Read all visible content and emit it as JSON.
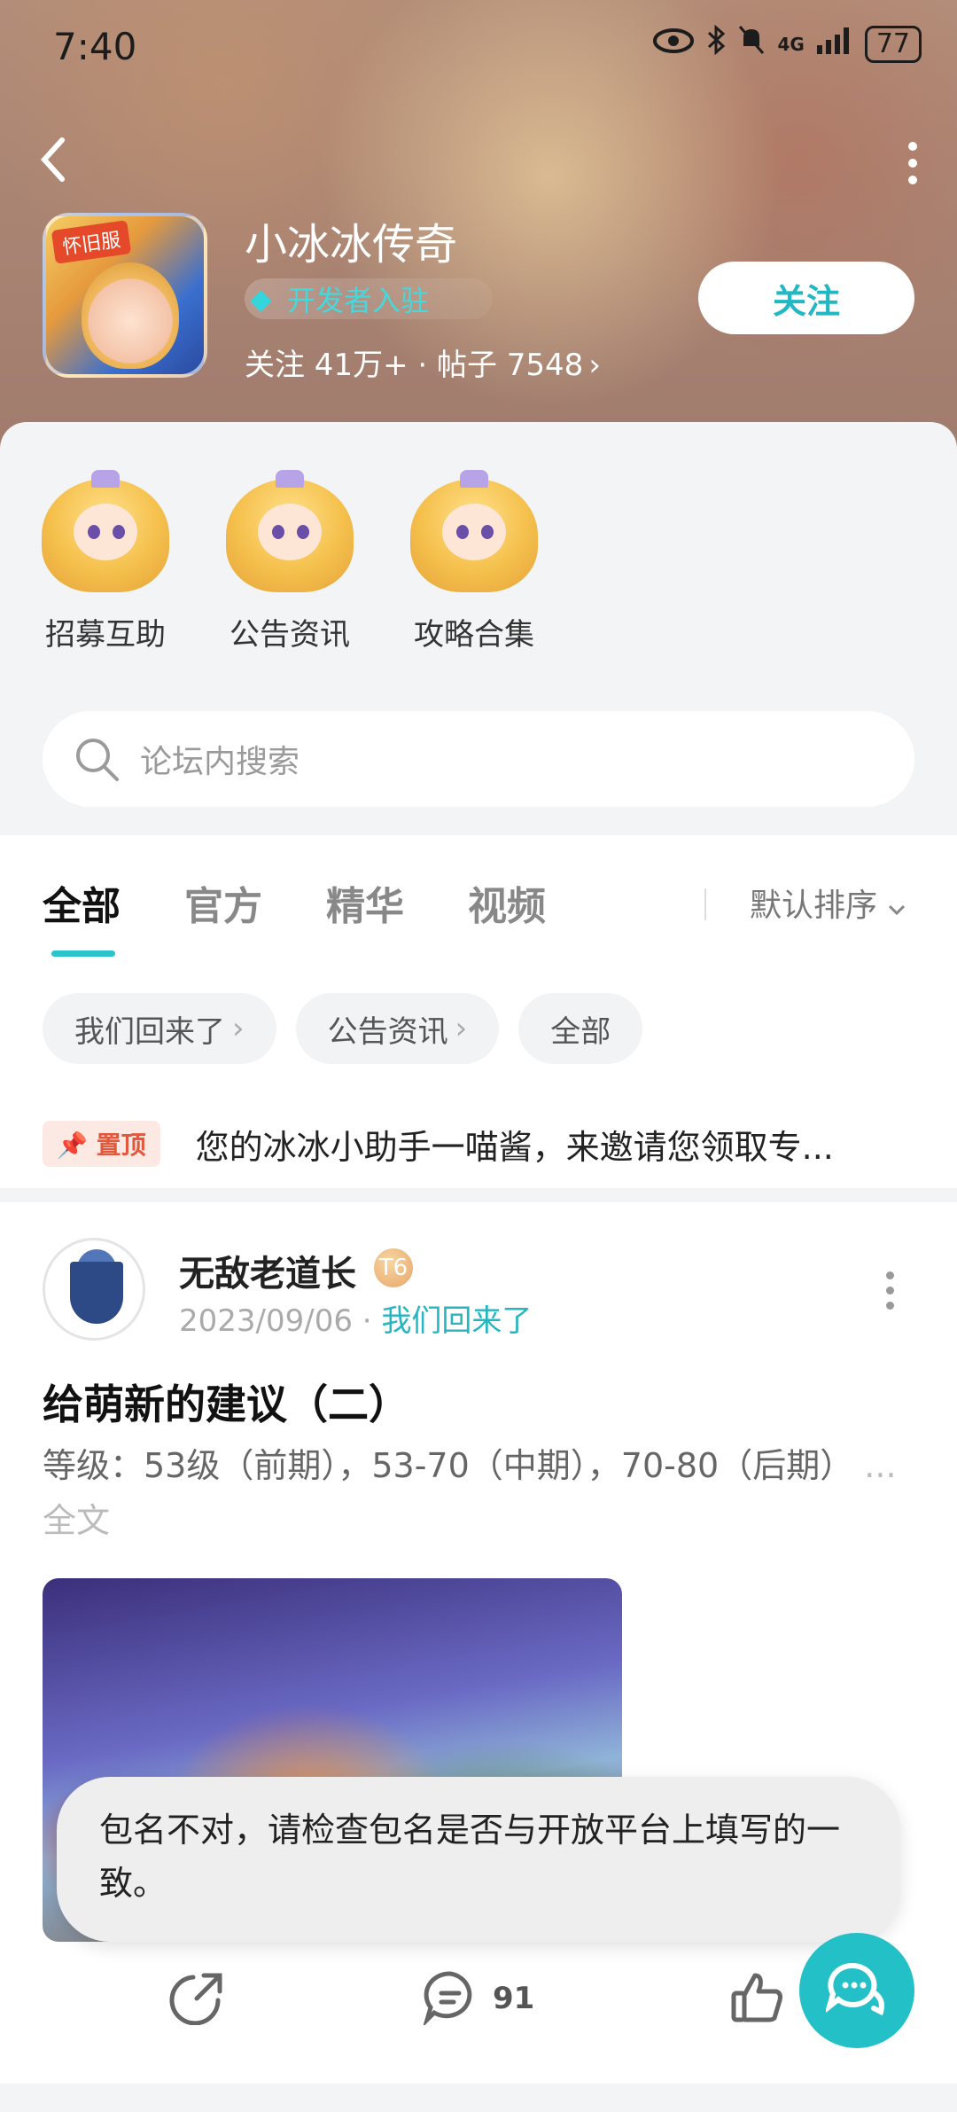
{
  "status_bar": {
    "time": "7:40",
    "network": "4G",
    "battery": "77"
  },
  "header": {
    "game_icon_tag": "怀旧服",
    "title": "小冰冰传奇",
    "dev_badge": "开发者入驻",
    "stats": "关注 41万+ · 帖子 7548",
    "follow_label": "关注"
  },
  "quick_links": [
    {
      "label": "招募互助"
    },
    {
      "label": "公告资讯"
    },
    {
      "label": "攻略合集"
    }
  ],
  "search": {
    "placeholder": "论坛内搜索"
  },
  "tabs": [
    {
      "label": "全部",
      "active": true
    },
    {
      "label": "官方"
    },
    {
      "label": "精华"
    },
    {
      "label": "视频"
    }
  ],
  "sort_label": "默认排序",
  "chips": [
    {
      "label": "我们回来了"
    },
    {
      "label": "公告资讯"
    },
    {
      "label": "全部"
    }
  ],
  "pinned": {
    "badge": "置顶",
    "text": "您的冰冰小助手一喵酱，来邀请您领取专..."
  },
  "post": {
    "author": "无敌老道长",
    "level": "T6",
    "date": "2023/09/06",
    "topic": "我们回来了",
    "title": "给萌新的建议（二）",
    "excerpt": "等级：53级（前期），53-70（中期），70-80（后期）",
    "more": "... 全文",
    "comment_count": "91"
  },
  "toast": {
    "text": "包名不对，请检查包名是否与开放平台上填写的一致。"
  },
  "colors": {
    "accent": "#24c0c8",
    "pin": "#e2583c"
  }
}
